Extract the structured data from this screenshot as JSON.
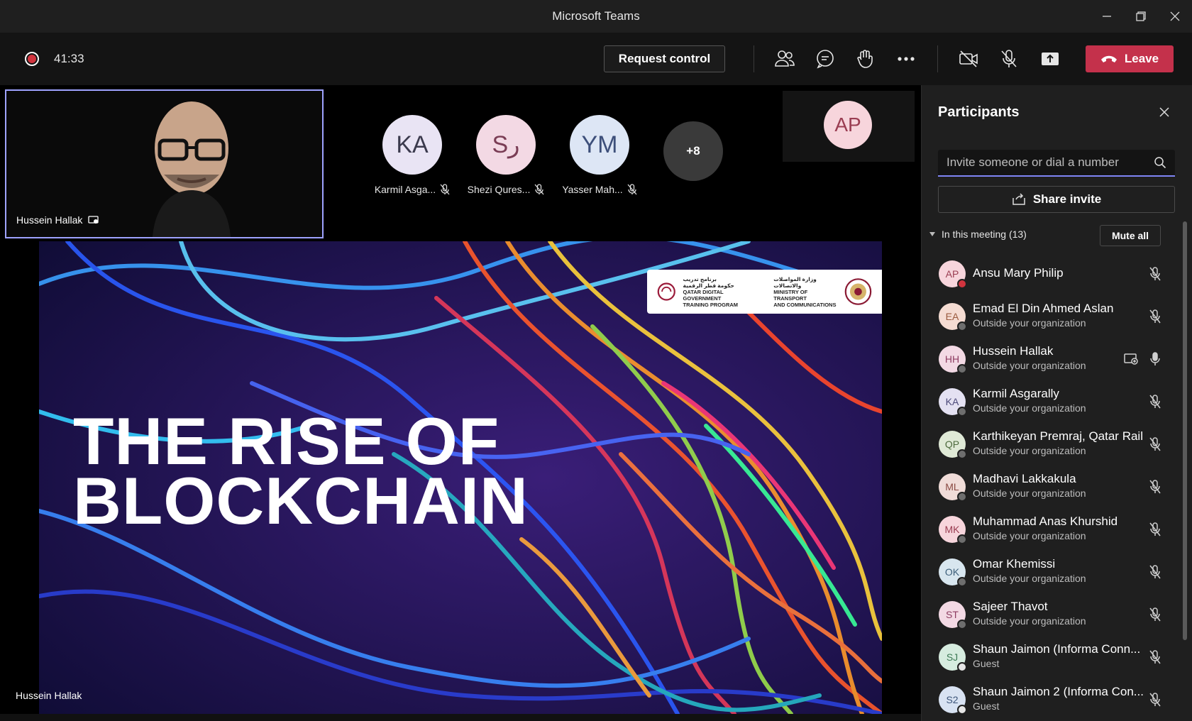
{
  "window": {
    "title": "Microsoft Teams"
  },
  "toolbar": {
    "timer": "41:33",
    "request_control_label": "Request control",
    "leave_label": "Leave",
    "colors": {
      "leave": "#c4314b",
      "accent": "#7f85f5"
    }
  },
  "stage": {
    "self_tile_name": "Hussein Hallak",
    "tiles": [
      {
        "initials": "KA",
        "name": "Karmil Asga...",
        "color": "#e9e4f4"
      },
      {
        "initials": "Sر",
        "name": "Shezi Qures...",
        "color": "#f3d9e4"
      },
      {
        "initials": "YM",
        "name": "Yasser Mah...",
        "color": "#dde6f5"
      }
    ],
    "more_count": "+8",
    "ap_initials": "AP",
    "slide_title_line1": "THE RISE OF",
    "slide_title_line2": "BLOCKCHAIN",
    "logo_left_ar": "برنامج تدريب",
    "logo_left_line1": "حكومة قطر الرقمية",
    "logo_left_line2": "QATAR DIGITAL GOVERNMENT",
    "logo_left_line3": "TRAINING PROGRAM",
    "logo_right_ar": "وزارة المواصلات والاتصالات",
    "logo_right_line1": "MINISTRY OF TRANSPORT",
    "logo_right_line2": "AND COMMUNICATIONS",
    "presenter_name": "Hussein Hallak"
  },
  "panel": {
    "title": "Participants",
    "invite_placeholder": "Invite someone or dial a number",
    "share_invite_label": "Share invite",
    "meeting_heading": "In this meeting (13)",
    "mute_all_label": "Mute all",
    "participants": [
      {
        "initials": "AP",
        "name": "Ansu Mary Philip",
        "sub": "",
        "bg": "#f7d5dc",
        "fg": "#9a3d52",
        "badge": "#d1343e"
      },
      {
        "initials": "EA",
        "name": "Emad El Din Ahmed Aslan",
        "sub": "Outside your organization",
        "bg": "#f5dcd2",
        "fg": "#9a5a3d",
        "badge": "#6e6e6e"
      },
      {
        "initials": "HH",
        "name": "Hussein Hallak",
        "sub": "Outside your organization",
        "bg": "#f3d9e4",
        "fg": "#8e3d62",
        "badge": "#6e6e6e"
      },
      {
        "initials": "KA",
        "name": "Karmil Asgarally",
        "sub": "Outside your organization",
        "bg": "#e4e1f2",
        "fg": "#4d4a7a",
        "badge": "#6e6e6e"
      },
      {
        "initials": "QP",
        "name": "Karthikeyan Premraj, Qatar Rail",
        "sub": "Outside your organization",
        "bg": "#dfe9d6",
        "fg": "#4d6a3d",
        "badge": "#6e6e6e"
      },
      {
        "initials": "ML",
        "name": "Madhavi Lakkakula",
        "sub": "Outside your organization",
        "bg": "#f0dcd8",
        "fg": "#8a4a42",
        "badge": "#6e6e6e"
      },
      {
        "initials": "MK",
        "name": "Muhammad Anas Khurshid",
        "sub": "Outside your organization",
        "bg": "#f7d5dc",
        "fg": "#9a3d52",
        "badge": "#6e6e6e"
      },
      {
        "initials": "OK",
        "name": "Omar Khemissi",
        "sub": "Outside your organization",
        "bg": "#d8e6ef",
        "fg": "#3d5f7a",
        "badge": "#6e6e6e"
      },
      {
        "initials": "ST",
        "name": "Sajeer Thavot",
        "sub": "Outside your organization",
        "bg": "#f3d9e4",
        "fg": "#8e3d62",
        "badge": "#6e6e6e"
      },
      {
        "initials": "SJ",
        "name": "Shaun Jaimon (Informa Conn...",
        "sub": "Guest",
        "bg": "#d6ecdf",
        "fg": "#3d7a55",
        "badge": "#e6e6e6"
      },
      {
        "initials": "S2",
        "name": "Shaun Jaimon 2 (Informa Con...",
        "sub": "Guest",
        "bg": "#d8e2f2",
        "fg": "#3d557a",
        "badge": "#e6e6e6"
      }
    ]
  }
}
